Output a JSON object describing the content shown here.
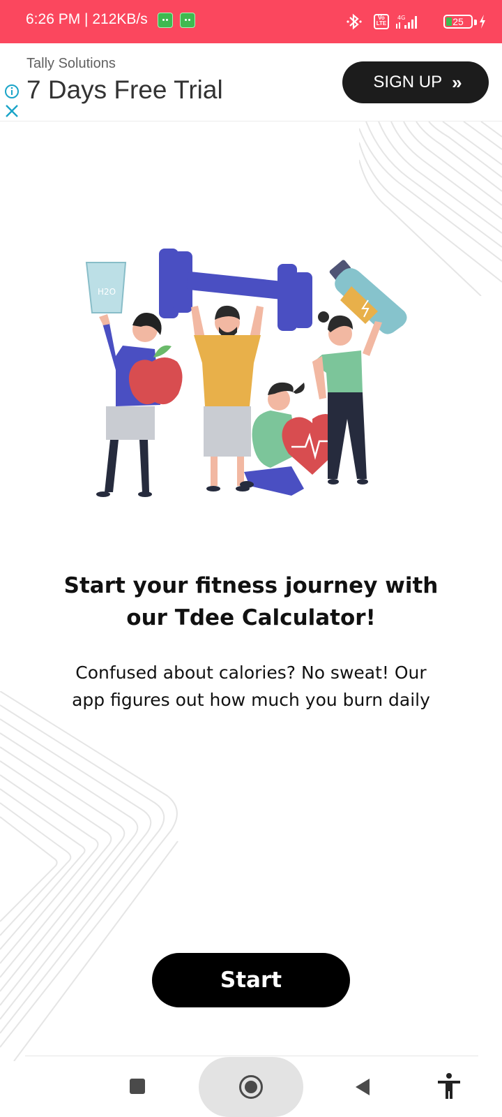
{
  "status_bar": {
    "time_speed": "6:26 PM | 212KB/s",
    "network": "4G",
    "volte": "Vo LTE",
    "battery": "25"
  },
  "ad": {
    "advertiser": "Tally Solutions",
    "headline": "7 Days Free Trial",
    "cta_label": "SIGN UP",
    "cta_chevrons": "»"
  },
  "main": {
    "headline": "Start your fitness journey with our Tdee Calculator!",
    "subtext": "Confused about calories? No sweat! Our app figures out how much you burn daily",
    "start_label": "Start"
  },
  "illustration": {
    "water_glass_label": "H2O"
  },
  "colors": {
    "status_bar": "#fb475e",
    "primary_button": "#000000",
    "ad_button": "#1c1c1c",
    "dumbbell": "#4a4fc2"
  },
  "icons": {
    "ad_info": "info-icon",
    "ad_close": "close-icon",
    "nav_recent": "square-icon",
    "nav_home": "circle-icon",
    "nav_back": "triangle-back-icon",
    "accessibility": "accessibility-icon"
  }
}
